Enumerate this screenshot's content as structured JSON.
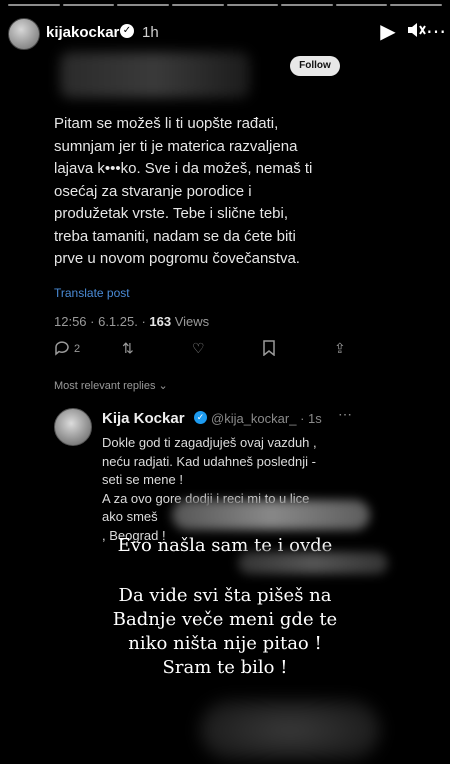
{
  "story": {
    "username": "kijakockar",
    "time": "1h",
    "segments": 8
  },
  "tweet": {
    "follow_label": "Follow",
    "text_lines": [
      "Pitam se možeš li ti uopšte rađati,",
      "sumnjam jer ti je materica razvaljena",
      "lajava k•••ko. Sve i da možeš, nemaš ti",
      "osećaj za stvaranje porodice i",
      "produžetak vrste. Tebe i slične tebi,",
      "treba tamaniti, nadam se da ćete biti",
      "prve u novom pogromu čovečanstva."
    ],
    "translate": "Translate post",
    "meta_time": "12:56 · 6.1.25. · ",
    "views_count": "163",
    "views_label": " Views",
    "reply_count": "2",
    "relevant_replies": "Most relevant replies ⌄"
  },
  "reply": {
    "name": "Kija Kockar",
    "handle": "@kija_kockar_ · 1s",
    "lines": [
      "Dokle god ti zagadjuješ ovaj vazduh ,",
      "neću radjati. Kad udahneš poslednji -",
      "seti se mene !",
      "A za ovo gore dodji i reci mi to u lice",
      "ako smeš",
      ", Beograd !"
    ]
  },
  "overlay": {
    "line1": "Evo našla sam te i ovde",
    "line2": "Da vide svi šta pišeš na",
    "line3": "Badnje veče meni gde te",
    "line4": "niko ništa nije pitao !",
    "line5": "Sram te bilo !"
  },
  "icons": {
    "play": "play-icon",
    "mute": "speaker-icon",
    "more": "more-icon",
    "reply": "comment-icon",
    "retweet": "retweet-icon",
    "like": "heart-icon",
    "bookmark": "bookmark-icon",
    "share": "share-icon"
  }
}
